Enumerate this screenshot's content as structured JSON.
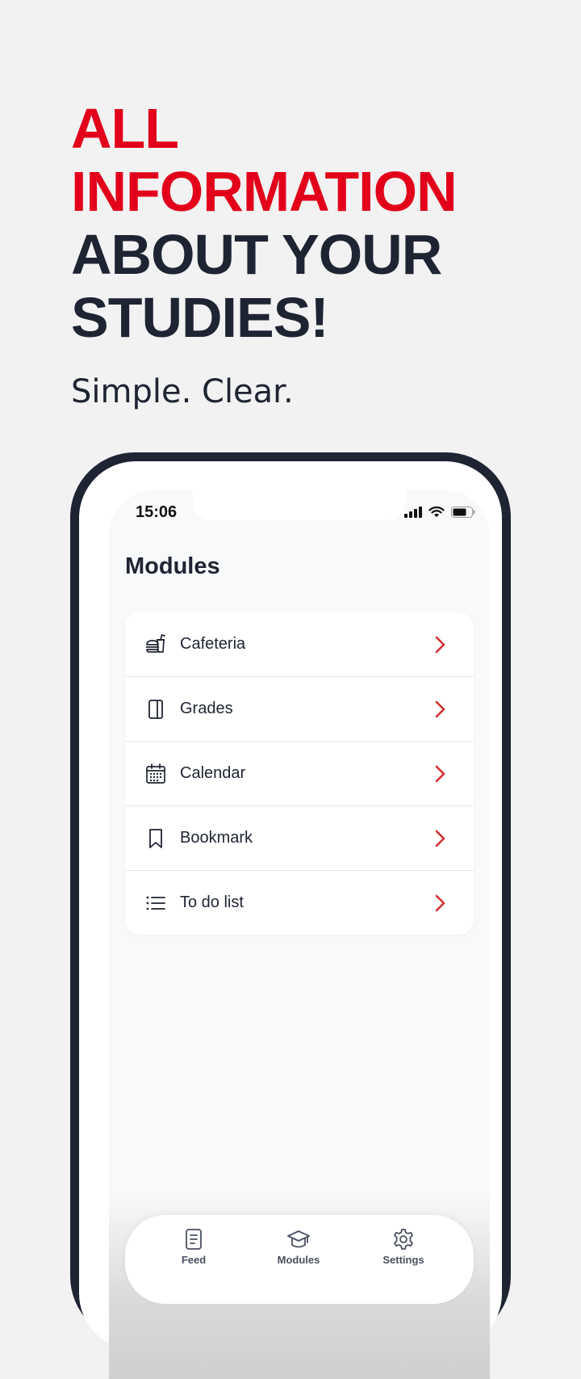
{
  "hero": {
    "line1": "ALL",
    "line2": "INFORMATION",
    "line3": "ABOUT YOUR",
    "line4": "STUDIES!",
    "subtitle": "Simple. Clear."
  },
  "status_bar": {
    "time": "15:06"
  },
  "screen": {
    "title": "Modules",
    "items": [
      {
        "label": "Cafeteria",
        "icon": "cafeteria-icon"
      },
      {
        "label": "Grades",
        "icon": "grades-book-icon"
      },
      {
        "label": "Calendar",
        "icon": "calendar-icon"
      },
      {
        "label": "Bookmark",
        "icon": "bookmark-icon"
      },
      {
        "label": "To do list",
        "icon": "list-icon"
      }
    ]
  },
  "tabbar": {
    "tabs": [
      {
        "label": "Feed",
        "icon": "feed-icon"
      },
      {
        "label": "Modules",
        "icon": "graduation-cap-icon"
      },
      {
        "label": "Settings",
        "icon": "gear-icon"
      }
    ]
  },
  "colors": {
    "accent_red": "#e2001a",
    "dark_navy": "#1f2433",
    "chevron_red": "#d32f2f",
    "background": "#f2f2f2"
  }
}
